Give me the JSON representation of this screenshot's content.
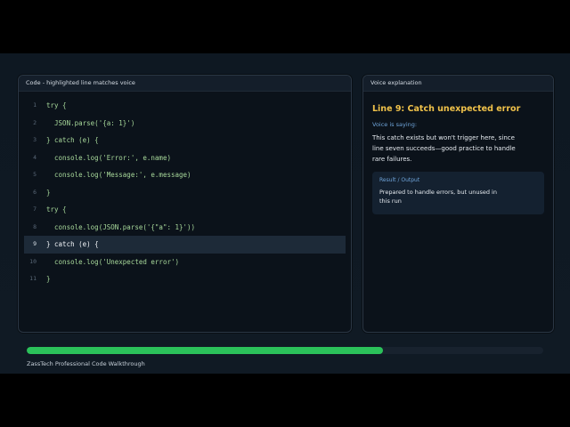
{
  "code_panel": {
    "header": "Code - highlighted line matches voice",
    "highlighted_line": 9,
    "lines": [
      {
        "num": "1",
        "text": "try {"
      },
      {
        "num": "2",
        "text": "  JSON.parse('{a: 1}')"
      },
      {
        "num": "3",
        "text": "} catch (e) {"
      },
      {
        "num": "4",
        "text": "  console.log('Error:', e.name)"
      },
      {
        "num": "5",
        "text": "  console.log('Message:', e.message)"
      },
      {
        "num": "6",
        "text": "}"
      },
      {
        "num": "7",
        "text": "try {"
      },
      {
        "num": "8",
        "text": "  console.log(JSON.parse('{\"a\": 1}'))"
      },
      {
        "num": "9",
        "text": "} catch (e) {"
      },
      {
        "num": "10",
        "text": "  console.log('Unexpected error')"
      },
      {
        "num": "11",
        "text": "}"
      }
    ]
  },
  "voice_panel": {
    "header": "Voice explanation",
    "title": "Line 9: Catch unexpected error",
    "saying_label": "Voice is saying:",
    "text": "This catch exists but won't trigger here, since line seven succeeds—good practice to handle rare failures.",
    "result": {
      "label": "Result / Output",
      "text": "Prepared to handle errors, but unused in this run"
    }
  },
  "progress": {
    "fraction": 0.69,
    "color": "#2bc15a"
  },
  "footer": {
    "label": "ZassTech Professional Code Walkthrough"
  },
  "colors": {
    "title_accent": "#f0c24a",
    "label_blue": "#6ea3d8",
    "code_green": "#a7d89a",
    "highlight_bg": "#1d2a38"
  }
}
